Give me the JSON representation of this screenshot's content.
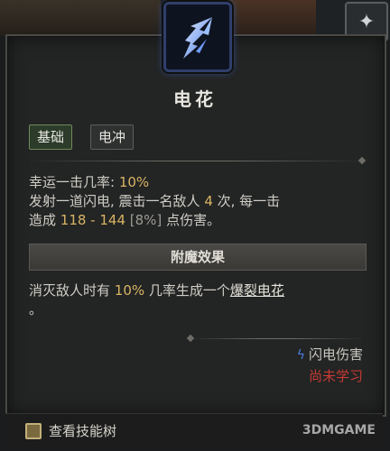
{
  "skill": {
    "name": "电花",
    "icon": "lightning-spark-icon",
    "tags": [
      "基础",
      "电冲"
    ]
  },
  "description": {
    "crit_label": "幸运一击几率: ",
    "crit_value": "10%",
    "line2_a": "发射一道闪电, 震击一名敌人 ",
    "hits": "4",
    "line2_b": " 次, 每一击",
    "line3_a": "造成 ",
    "damage_range": "118 - 144",
    "damage_pct": "[8%]",
    "line3_b": " 点伤害。"
  },
  "enchantment": {
    "title": "附魔效果",
    "text_a": "消灭敌人时有 ",
    "chance": "10%",
    "text_b": " 几率生成一个",
    "link": "爆裂电花",
    "text_c": "。"
  },
  "damage_type": "闪电伤害",
  "status": "尚未学习",
  "footer": {
    "skill_tree_label": "查看技能树",
    "watermark": "3DMGAME"
  },
  "colors": {
    "highlight": "#d8b564",
    "unlearned": "#c53a33",
    "lightning": "#4c7de0"
  }
}
